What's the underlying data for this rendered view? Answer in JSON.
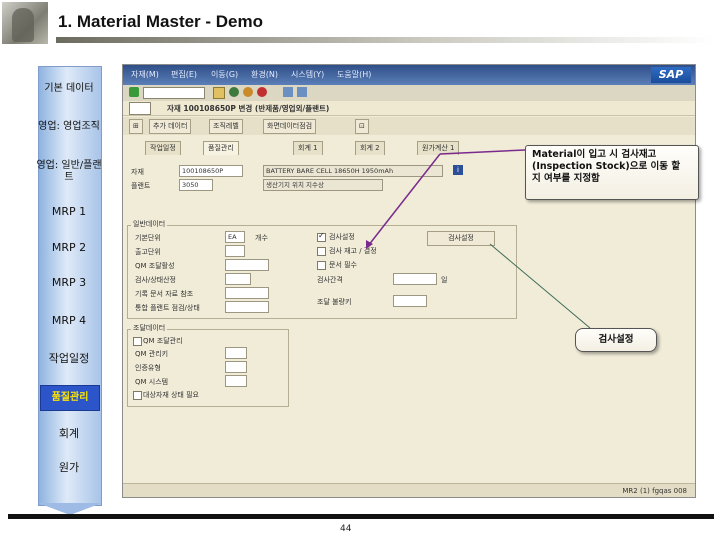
{
  "slide": {
    "title": "1. Material Master - Demo",
    "page_number": "44"
  },
  "process_steps": [
    "기본 데이터",
    "영업: 영업조직",
    "영업: 일반/플랜트",
    "MRP 1",
    "MRP 2",
    "MRP 3",
    "MRP 4",
    "작업일정",
    "품질관리",
    "회계",
    "원가"
  ],
  "active_step": "품질관리",
  "sap": {
    "menus": [
      "자재(M)",
      "편집(E)",
      "이동(G)",
      "환경(N)",
      "시스템(Y)",
      "도움말(H)"
    ],
    "logo": "SAP",
    "title": "자재 100108650P 변경 (반제품/영업외/플랜트)",
    "app_buttons": [
      "추가 데이터",
      "조직레벨",
      "화면데이터점검"
    ],
    "tabs": [
      "작업일정",
      "품질관리",
      "회계 1",
      "회계 2",
      "원가계산 1"
    ],
    "header": {
      "material_label": "자재",
      "material_value": "100108650P",
      "material_desc": "BATTERY BARE CELL 18650H 1950mAh",
      "plant_label": "플랜트",
      "plant_value": "3050",
      "plant_desc": "생산기지 위치 지수상"
    },
    "general_group": {
      "title": "일반데이터",
      "fields": [
        {
          "label": "기본단위",
          "value": "EA",
          "unit": "개수"
        },
        {
          "label": "출고단위",
          "value": ""
        },
        {
          "label": "QM 조달활성",
          "value": ""
        },
        {
          "label": "검사/상태산정",
          "value": ""
        },
        {
          "label": "기록 문서 자료 참조",
          "value": ""
        },
        {
          "label": "통합 플랜트 점검/상태",
          "value": ""
        }
      ],
      "checkboxes": [
        {
          "label": "검사설정",
          "checked": true
        },
        {
          "label": "검사 재고 / 결정",
          "checked": false
        },
        {
          "label": "문서 필수",
          "checked": false
        }
      ],
      "extra": [
        {
          "label": "검사간격",
          "unit": "일"
        },
        {
          "label": "조달 불량키",
          "value": ""
        }
      ],
      "inspection_button": "검사설정"
    },
    "procure_group": {
      "title": "조달데이터",
      "rows": [
        {
          "label": "QM 조달관리",
          "checked": false
        },
        {
          "label": "QM 관리키",
          "value": ""
        },
        {
          "label": "인증유형",
          "value": ""
        },
        {
          "label": "QM 시스템",
          "value": ""
        },
        {
          "label": "대상자재 상태 필요",
          "checked": false
        }
      ]
    },
    "status_text": "MR2 (1) fgqas 008"
  },
  "callouts": {
    "inspection_stock": "Material이 입고 시 검사재고 (Inspection Stock)으로 이동 할 지 여부를 지정함",
    "inspection_setting": "검사설정"
  },
  "colors": {
    "callout_arrow": "#7a2a8c",
    "active_step_bg": "#2b55c9",
    "active_step_text": "#ffe600"
  }
}
